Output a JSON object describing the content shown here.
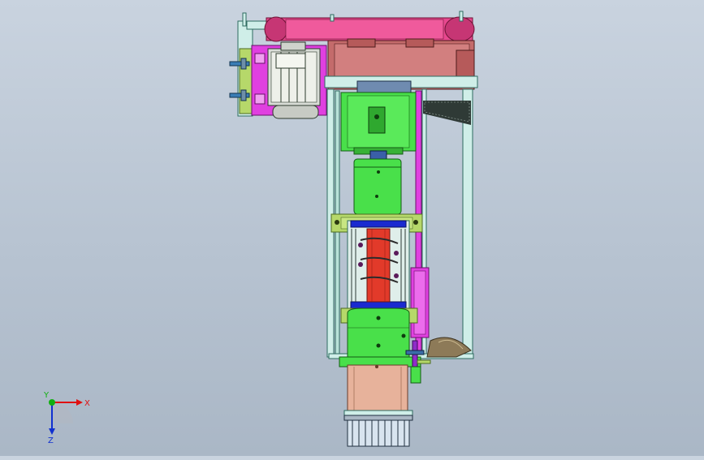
{
  "viewport": {
    "background_top": "#c9d3df",
    "background_bottom": "#aab7c6"
  },
  "colors": {
    "frame": "#cfeee8",
    "frame_edge": "#2e6b5f",
    "pulley_pink": "#e8488f",
    "gearbox": "#c46b6b",
    "motor_magenta": "#e040e0",
    "motor_grey": "#d8dcd6",
    "housing_green": "#49e04a",
    "rotor_red": "#e23a2a",
    "bowl_salmon": "#e7b29b",
    "flange_olive": "#b6d86a",
    "mesh_dark": "#2f3a36",
    "chute_brown": "#8d7a58",
    "cage_blue": "#1a2ad0"
  },
  "triad": {
    "x_label": "X",
    "y_label": "Y",
    "z_label": "Z",
    "x_color": "#e01010",
    "y_color": "#10b010",
    "z_color": "#1030d0",
    "icon": "axis-triad-icon"
  }
}
